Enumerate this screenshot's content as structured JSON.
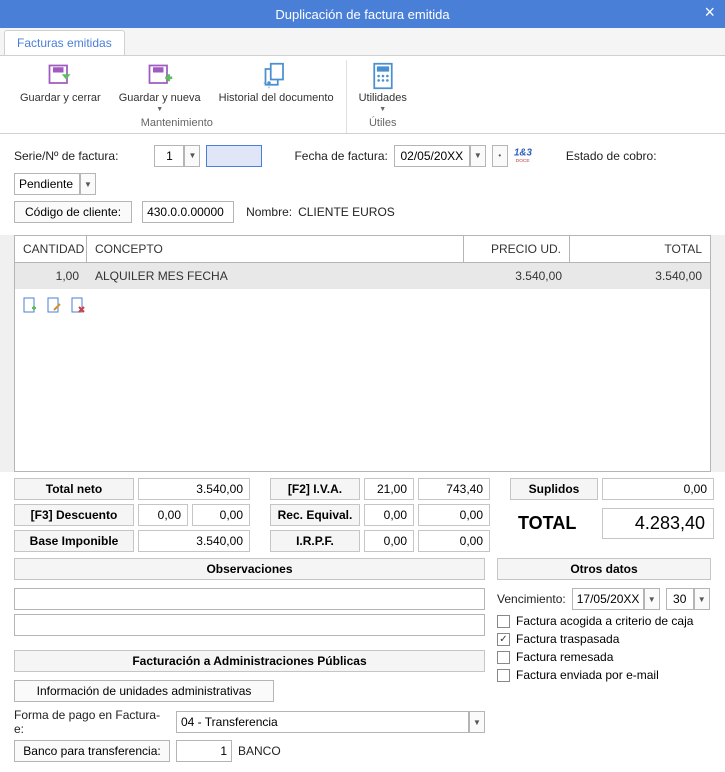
{
  "window": {
    "title": "Duplicación de factura emitida"
  },
  "tab": {
    "label": "Facturas emitidas"
  },
  "ribbon": {
    "save_close": "Guardar y cerrar",
    "save_new": "Guardar y nueva",
    "history": "Historial del documento",
    "utils": "Utilidades",
    "group_maint": "Mantenimiento",
    "group_utils": "Útiles"
  },
  "form": {
    "serie_lbl": "Serie/Nº de factura:",
    "serie_val": "1",
    "num_val": "",
    "fecha_lbl": "Fecha de factura:",
    "fecha_val": "02/05/20XX",
    "estado_lbl": "Estado de cobro:",
    "estado_val": "Pendiente",
    "codigo_btn": "Código de cliente:",
    "codigo_val": "430.0.0.00000",
    "nombre_lbl": "Nombre:",
    "nombre_val": "CLIENTE EUROS"
  },
  "grid": {
    "h_cant": "CANTIDAD",
    "h_conc": "CONCEPTO",
    "h_prec": "PRECIO UD.",
    "h_tot": "TOTAL",
    "row": {
      "cant": "1,00",
      "conc": "ALQUILER MES FECHA",
      "prec": "3.540,00",
      "tot": "3.540,00"
    }
  },
  "totals": {
    "neto_lbl": "Total neto",
    "neto_val": "3.540,00",
    "desc_lbl": "[F3] Descuento",
    "desc_pct": "0,00",
    "desc_val": "0,00",
    "base_lbl": "Base Imponible",
    "base_val": "3.540,00",
    "iva_lbl": "[F2] I.V.A.",
    "iva_pct": "21,00",
    "iva_val": "743,40",
    "rec_lbl": "Rec. Equival.",
    "rec_pct": "0,00",
    "rec_val": "0,00",
    "irpf_lbl": "I.R.P.F.",
    "irpf_pct": "0,00",
    "irpf_val": "0,00",
    "supl_lbl": "Suplidos",
    "supl_val": "0,00",
    "total_lbl": "TOTAL",
    "total_val": "4.283,40"
  },
  "obs": {
    "header": "Observaciones"
  },
  "fact_pub": {
    "header": "Facturación a Administraciones Públicas",
    "info_btn": "Información de unidades administrativas",
    "forma_lbl": "Forma de pago en Factura-e:",
    "forma_val": "04 - Transferencia",
    "banco_lbl": "Banco para transferencia:",
    "banco_num": "1",
    "banco_nom": "BANCO"
  },
  "otros": {
    "header": "Otros datos",
    "venc_lbl": "Vencimiento:",
    "venc_val": "17/05/20XX",
    "venc_dias": "30",
    "chk1": "Factura acogida a criterio de caja",
    "chk2": "Factura traspasada",
    "chk3": "Factura remesada",
    "chk4": "Factura enviada por e-mail"
  }
}
